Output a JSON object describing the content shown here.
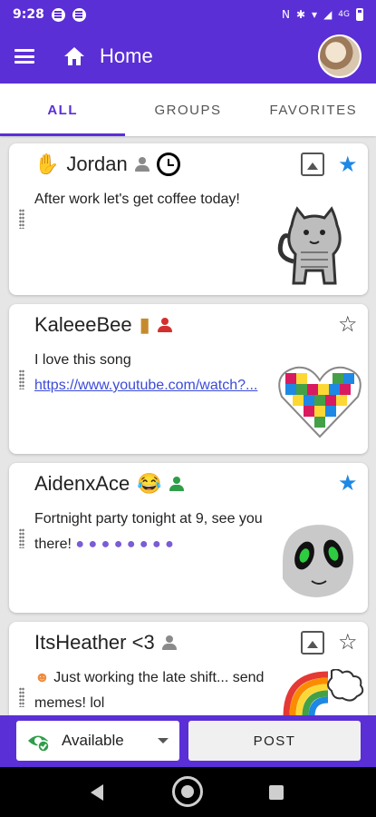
{
  "status_bar": {
    "time": "9:28",
    "network": "4G"
  },
  "app_bar": {
    "title": "Home"
  },
  "tabs": [
    {
      "label": "ALL",
      "active": true
    },
    {
      "label": "GROUPS",
      "active": false
    },
    {
      "label": "FAVORITES",
      "active": false
    }
  ],
  "posts": [
    {
      "name": "Jordan",
      "message": "After work let's get coffee today!",
      "favorited": true
    },
    {
      "name": "KaleeeBee",
      "message": "I love this song",
      "link": "https://www.youtube.com/watch?...",
      "favorited": false
    },
    {
      "name": "AidenxAce",
      "message": "Fortnight party tonight at 9, see you there!",
      "favorited": true
    },
    {
      "name": "ItsHeather <3",
      "message": "Just working the late shift... send memes! lol",
      "favorited": false
    }
  ],
  "bottom_bar": {
    "status_label": "Available",
    "post_label": "POST"
  },
  "colors": {
    "primary": "#5b2fd6",
    "star_active": "#1e88e5",
    "link": "#3b4bd9",
    "status_available": "#2e9e49",
    "status_busy": "#d32f2f"
  }
}
